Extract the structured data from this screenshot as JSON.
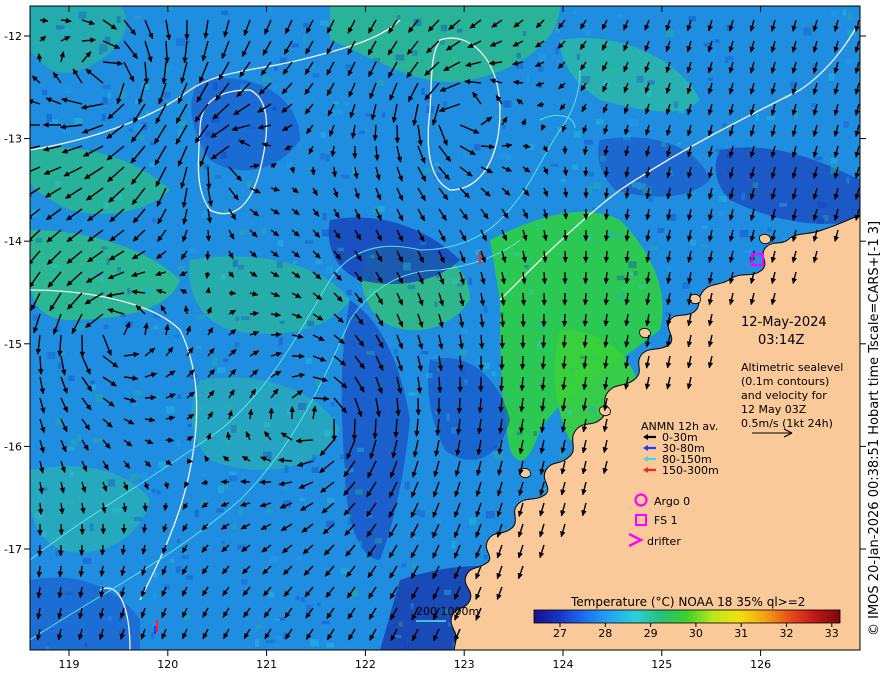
{
  "map": {
    "date": "12-May-2024",
    "time": "03:14Z",
    "side_caption": "© IMOS 20-Jan-2026 00:38:51 Hobart time Tscale=CARS+[-1 3]",
    "altimetry_note": [
      "Altimetric sealevel",
      "(0.1m contours)",
      "and velocity for",
      "12 May 03Z",
      "0.5m/s (1kt 24h)"
    ],
    "lon_ticks": [
      "119",
      "120",
      "121",
      "122",
      "123",
      "124",
      "125",
      "126"
    ],
    "lat_ticks": [
      "-12",
      "-13",
      "-14",
      "-15",
      "-16",
      "-17"
    ],
    "bathy_label": "200  1000m",
    "colors": {
      "land": "#f9c99a",
      "sea_base": "#1f8ee0",
      "contour": "#f2f2f2",
      "bathy": "#5de0e6",
      "marker": "#ff00ff"
    }
  },
  "mooring_legend": {
    "title": "ANMN 12h av.",
    "items": [
      {
        "label": "0-30m",
        "color": "#000000"
      },
      {
        "label": "30-80m",
        "color": "#1f3bff"
      },
      {
        "label": "80-150m",
        "color": "#4fd1e0"
      },
      {
        "label": "150-300m",
        "color": "#ff2020"
      }
    ]
  },
  "platform_legend": [
    {
      "symbol": "circle",
      "label": "Argo 0"
    },
    {
      "symbol": "square",
      "label": "FS 1"
    },
    {
      "symbol": "chevron",
      "label": "drifter"
    }
  ],
  "colorbar": {
    "title": "Temperature (°C) NOAA 18 35% ql>=2",
    "ticks": [
      "27",
      "28",
      "29",
      "30",
      "31",
      "32",
      "33"
    ],
    "colors": [
      "#1a0f8a",
      "#1536c8",
      "#1f6ff0",
      "#24a7f2",
      "#2dcfd8",
      "#27c07a",
      "#3fd02a",
      "#b8e81a",
      "#f2e20f",
      "#f5a612",
      "#e8501b",
      "#c0181a",
      "#7a0a0a"
    ]
  }
}
